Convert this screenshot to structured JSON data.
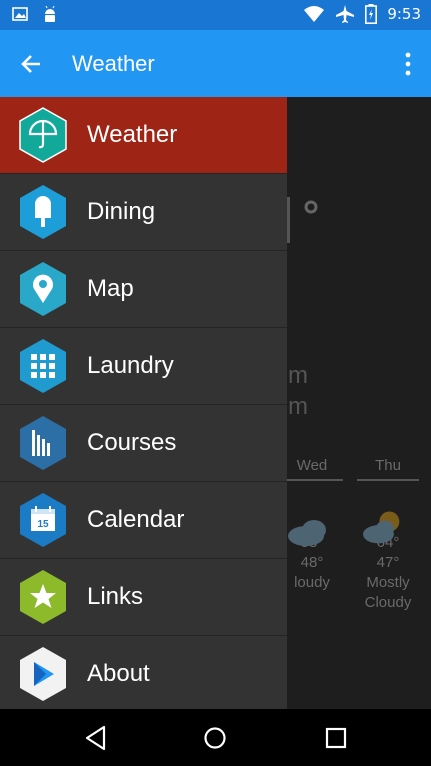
{
  "status_bar": {
    "time": "9:53",
    "left_icons": [
      "image-icon",
      "android-icon"
    ],
    "right_icons": [
      "wifi-icon",
      "airplane-icon",
      "battery-icon"
    ]
  },
  "app_bar": {
    "title": "Weather",
    "back_icon": "arrow-left-icon",
    "menu_icon": "more-vert-icon"
  },
  "background": {
    "partial_texts": [
      "m",
      "m"
    ],
    "forecast": [
      {
        "day": "Wed",
        "high": "58°",
        "low": "48°",
        "condition": "loudy"
      },
      {
        "day": "Thu",
        "high": "64°",
        "low": "47°",
        "condition": "Mostly Cloudy"
      }
    ]
  },
  "drawer": {
    "items": [
      {
        "label": "Weather",
        "icon": "umbrella-icon",
        "color": "#12a89a"
      },
      {
        "label": "Dining",
        "icon": "popsicle-icon",
        "color": "#1e9ed8"
      },
      {
        "label": "Map",
        "icon": "map-pin-icon",
        "color": "#2aa8c9"
      },
      {
        "label": "Laundry",
        "icon": "grid-icon",
        "color": "#1f9bd0"
      },
      {
        "label": "Courses",
        "icon": "courses-icon",
        "color": "#2b6fa6"
      },
      {
        "label": "Calendar",
        "icon": "calendar-icon",
        "color": "#1b7bc4",
        "calendar_day": "15"
      },
      {
        "label": "Links",
        "icon": "star-icon",
        "color": "#8dba2a"
      },
      {
        "label": "About",
        "icon": "play-icon",
        "color": "#f2f2f2"
      }
    ]
  },
  "colors": {
    "status_bar": "#1976d2",
    "app_bar": "#2196f3",
    "drawer_bg": "#333333",
    "active_item": "#9e2516"
  },
  "nav_bar": {
    "icons": [
      "back-triangle-icon",
      "home-circle-icon",
      "recents-square-icon"
    ]
  }
}
